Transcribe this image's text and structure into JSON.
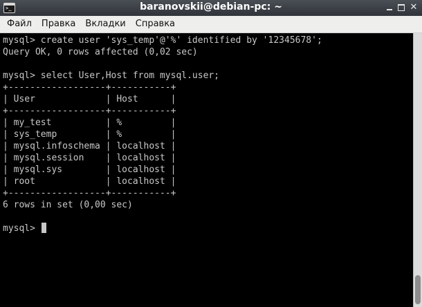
{
  "window": {
    "title": "baranovskii@debian-pc: ~",
    "icon": "terminal-icon",
    "controls": {
      "minimize_icon": "minimize-icon",
      "maximize_icon": "maximize-icon",
      "close_glyph": "✕"
    }
  },
  "menubar": {
    "items": [
      {
        "label": "Файл"
      },
      {
        "label": "Правка"
      },
      {
        "label": "Вкладки"
      },
      {
        "label": "Справка"
      }
    ]
  },
  "terminal": {
    "lines": [
      "mysql> create user 'sys_temp'@'%' identified by '12345678';",
      "Query OK, 0 rows affected (0,02 sec)",
      "",
      "mysql> select User,Host from mysql.user;",
      "+------------------+-----------+",
      "| User             | Host      |",
      "+------------------+-----------+",
      "| my_test          | %         |",
      "| sys_temp         | %         |",
      "| mysql.infoschema | localhost |",
      "| mysql.session    | localhost |",
      "| mysql.sys        | localhost |",
      "| root             | localhost |",
      "+------------------+-----------+",
      "6 rows in set (0,00 sec)",
      "",
      "mysql> "
    ],
    "text_color": "#c8c8c8",
    "background": "#000000"
  }
}
